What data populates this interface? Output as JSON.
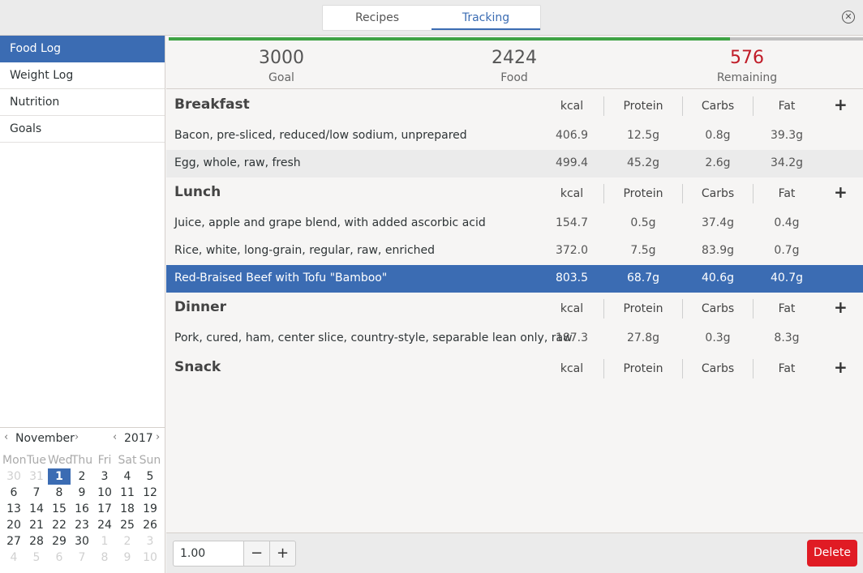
{
  "header": {
    "tabs": [
      {
        "label": "Recipes",
        "active": false
      },
      {
        "label": "Tracking",
        "active": true
      }
    ],
    "close_icon": "close-circle-icon"
  },
  "sidebar": {
    "items": [
      {
        "label": "Food Log",
        "active": true
      },
      {
        "label": "Weight Log",
        "active": false
      },
      {
        "label": "Nutrition",
        "active": false
      },
      {
        "label": "Goals",
        "active": false
      }
    ]
  },
  "calendar": {
    "month": "November",
    "year": "2017",
    "weekdays": [
      "Mon",
      "Tue",
      "Wed",
      "Thu",
      "Fri",
      "Sat",
      "Sun"
    ],
    "weeks": [
      [
        {
          "d": "30",
          "o": true
        },
        {
          "d": "31",
          "o": true
        },
        {
          "d": "1",
          "s": true
        },
        {
          "d": "2"
        },
        {
          "d": "3"
        },
        {
          "d": "4"
        },
        {
          "d": "5"
        }
      ],
      [
        {
          "d": "6"
        },
        {
          "d": "7"
        },
        {
          "d": "8"
        },
        {
          "d": "9"
        },
        {
          "d": "10"
        },
        {
          "d": "11"
        },
        {
          "d": "12"
        }
      ],
      [
        {
          "d": "13"
        },
        {
          "d": "14"
        },
        {
          "d": "15"
        },
        {
          "d": "16"
        },
        {
          "d": "17"
        },
        {
          "d": "18"
        },
        {
          "d": "19"
        }
      ],
      [
        {
          "d": "20"
        },
        {
          "d": "21"
        },
        {
          "d": "22"
        },
        {
          "d": "23"
        },
        {
          "d": "24"
        },
        {
          "d": "25"
        },
        {
          "d": "26"
        }
      ],
      [
        {
          "d": "27"
        },
        {
          "d": "28"
        },
        {
          "d": "29"
        },
        {
          "d": "30"
        },
        {
          "d": "1",
          "o": true
        },
        {
          "d": "2",
          "o": true
        },
        {
          "d": "3",
          "o": true
        }
      ],
      [
        {
          "d": "4",
          "o": true
        },
        {
          "d": "5",
          "o": true
        },
        {
          "d": "6",
          "o": true
        },
        {
          "d": "7",
          "o": true
        },
        {
          "d": "8",
          "o": true
        },
        {
          "d": "9",
          "o": true
        },
        {
          "d": "10",
          "o": true
        }
      ]
    ]
  },
  "summary": {
    "goal_value": "3000",
    "goal_label": "Goal",
    "food_value": "2424",
    "food_label": "Food",
    "remaining_value": "576",
    "remaining_label": "Remaining",
    "progress_fraction": 0.808
  },
  "columns": {
    "kcal": "kcal",
    "protein": "Protein",
    "carbs": "Carbs",
    "fat": "Fat",
    "add": "+"
  },
  "meals": [
    {
      "name": "Breakfast",
      "foods": [
        {
          "name": "Bacon, pre-sliced, reduced/low sodium, unprepared",
          "kcal": "406.9",
          "protein": "12.5g",
          "carbs": "0.8g",
          "fat": "39.3g",
          "style": ""
        },
        {
          "name": "Egg, whole, raw, fresh",
          "kcal": "499.4",
          "protein": "45.2g",
          "carbs": "2.6g",
          "fat": "34.2g",
          "style": "alt"
        }
      ]
    },
    {
      "name": "Lunch",
      "foods": [
        {
          "name": "Juice, apple and grape blend, with added ascorbic acid",
          "kcal": "154.7",
          "protein": "0.5g",
          "carbs": "37.4g",
          "fat": "0.4g",
          "style": ""
        },
        {
          "name": "Rice, white, long-grain, regular, raw, enriched",
          "kcal": "372.0",
          "protein": "7.5g",
          "carbs": "83.9g",
          "fat": "0.7g",
          "style": ""
        },
        {
          "name": "Red-Braised Beef with Tofu \"Bamboo\"",
          "kcal": "803.5",
          "protein": "68.7g",
          "carbs": "40.6g",
          "fat": "40.7g",
          "style": "sel"
        }
      ]
    },
    {
      "name": "Dinner",
      "foods": [
        {
          "name": "Pork, cured, ham, center slice, country-style, separable lean only, raw",
          "kcal": "187.3",
          "protein": "27.8g",
          "carbs": "0.3g",
          "fat": "8.3g",
          "style": ""
        }
      ]
    },
    {
      "name": "Snack",
      "foods": []
    }
  ],
  "bottombar": {
    "quantity": "1.00",
    "minus_label": "−",
    "plus_label": "+",
    "delete_label": "Delete"
  }
}
